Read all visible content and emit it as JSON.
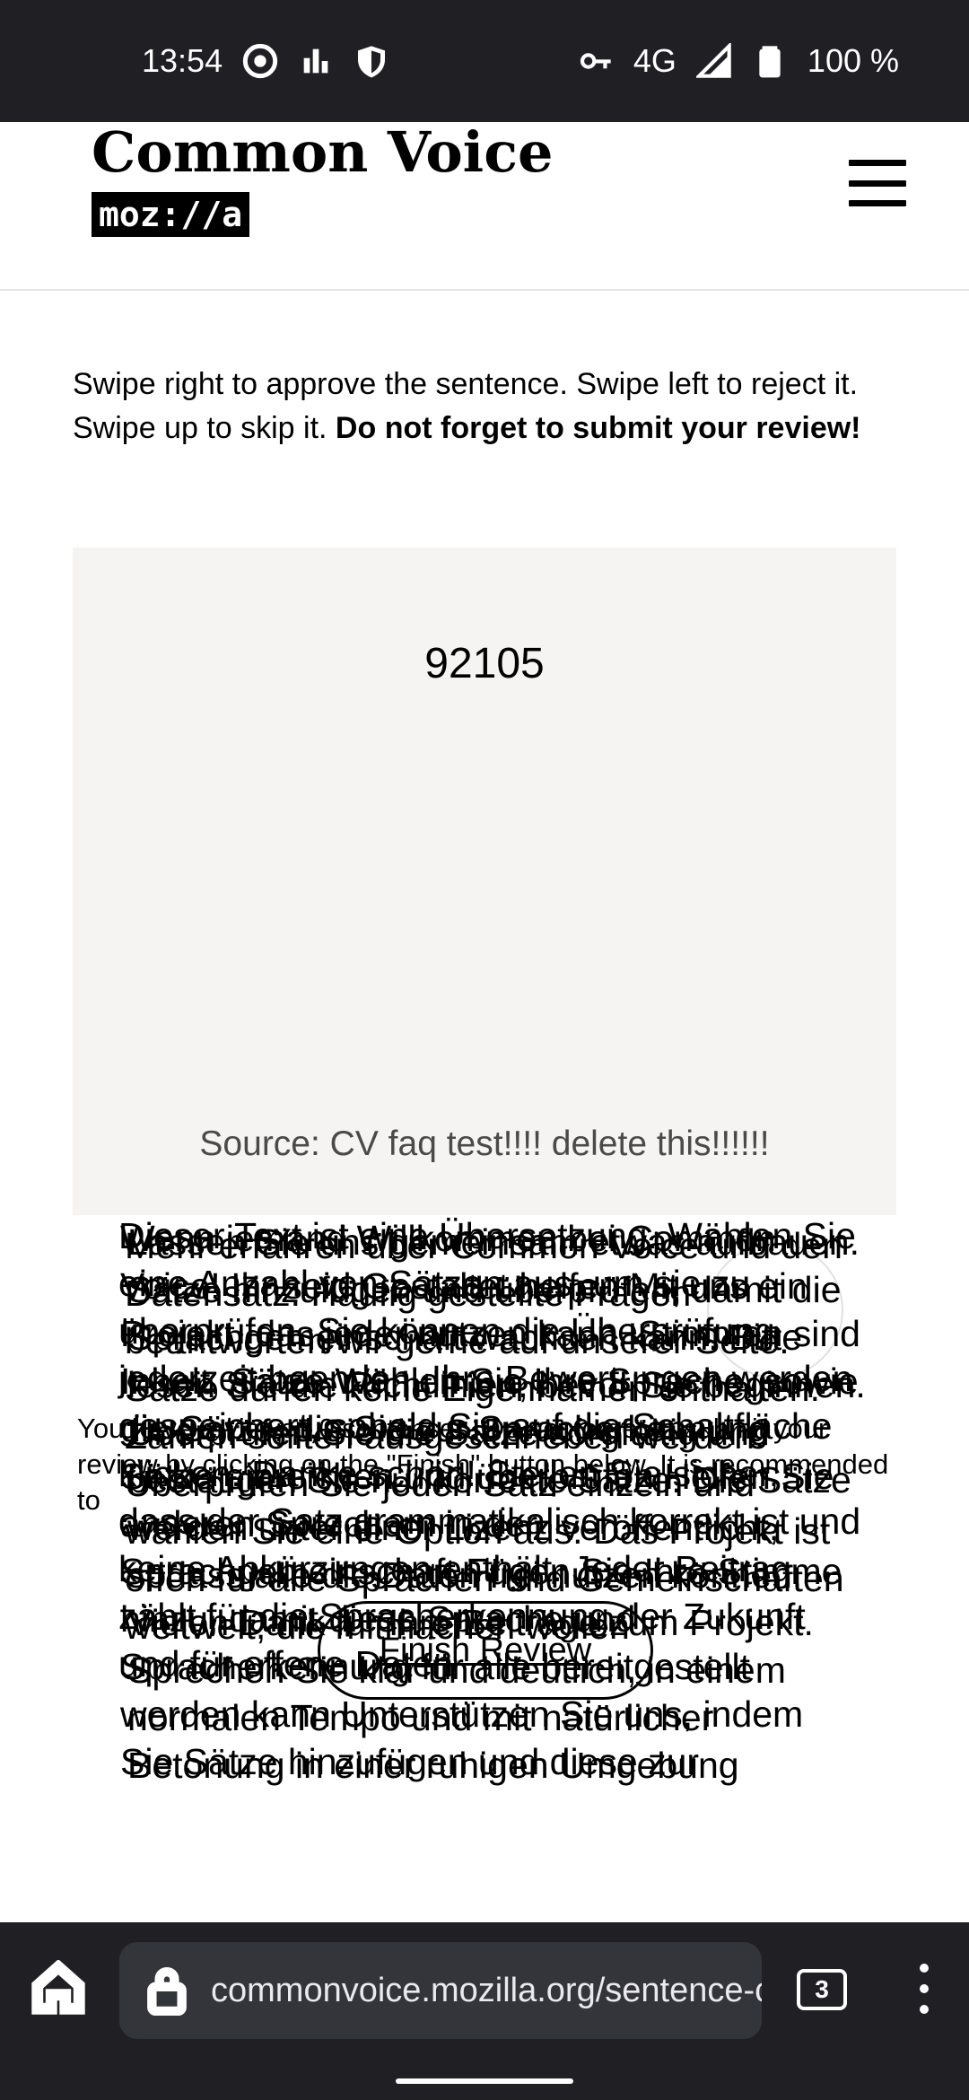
{
  "status_bar": {
    "time": "13:54",
    "network": "4G",
    "battery": "100 %",
    "icons": [
      "g-circle-icon",
      "signal-bars-icon",
      "shield-icon",
      "key-icon",
      "cell-signal-icon",
      "battery-icon"
    ]
  },
  "header": {
    "logo_title": "Common Voice",
    "logo_badge": "moz://a",
    "menu_icon": "hamburger-menu-icon"
  },
  "instructions": {
    "text": "Swipe right to approve the sentence. Swipe left to reject it. Swipe up to skip it. ",
    "bold": "Do not forget to submit your review!"
  },
  "card": {
    "sentence": "92105",
    "source": "Source: CV faq test!!!! delete this!!!!!!"
  },
  "review": {
    "count_text": "You have reviewed 0 sentences. Do not forget to submit your review by clicking on the \"Finish\" button below. It is recommended to",
    "finish_label": "Finish Review"
  },
  "overlay_text": [
    "Wenn jemand Willkommen bei Common Voice! Ihr seid Gestaltet helfen Mit uns ein Projekt, das jeder nutzen kann. Stimmen sind Inhalt, Sätze Wählen Sie Ihre Sprache, sowie die Sätze, die Sie zur Spracherkennung Sätze einreichen und überprüfen Helfen Sie anderen Sprechern in der Sprachgemeinschaft Fügen Sie Ihre Stimme hinzu, damit diese Sprache und Spracherkennung für alle bereitgestellt werden kann Unterstützen Sie uns, indem Sie Sätze hinzufügen und diese zur",
    "Lassen Sie uns gemeinsam etwas aufbauen. Sätze hinzufügen und überprüfen, damit die Sprachgemeinschaft wachsen kann. Bitte lesen Sie die Richtlinien, bevor Sie beginnen. Überprüfen Sie die Sätze sorgfältig und bestätigen Sie nur korrekte Sätze. Die Sätze werden unter einer Lizenz veröffentlicht, sodass alle die Daten frei nutzen können. Vielen Dank für Ihre Beiträge zum Projekt. Sprechen Sie klar und deutlich, in einem normalen Tempo und mit natürlicher Betonung in einer ruhigen Umgebung",
    "Dieser Text ist eine Übersetzung. Wählen Sie eine Anzahl von Sätzen aus, um sie zu überprüfen. Sie können die Überprüfung jederzeit beenden. Ihre Bewertungen werden gespeichert, sobald Sie auf die Schaltfläche klicken. Danke schön! Stellen Sie sicher, dass der Satz grammatikalisch korrekt ist und keine Abkürzungen enthält. Jeder Beitrag zählt für die Spracherkennung der Zukunft und für offene Daten",
    "Mehr erfahren über Common Voice und den Datensatz. Häufig gestellte Fragen beantworten wir gerne auf unserer Seite. Sätze dürfen keine Eigennamen enthalten. Zahlen sollten ausgeschrieben werden. Überprüfen Sie jeden Satz einzeln und wählen Sie eine Option aus. Das Projekt ist offen für alle Sprachen und Gemeinschaften weltweit, die mitmachen wollen"
  ],
  "browser": {
    "url": "commonvoice.mozilla.org/sentence-collector",
    "tab_count": "3"
  }
}
